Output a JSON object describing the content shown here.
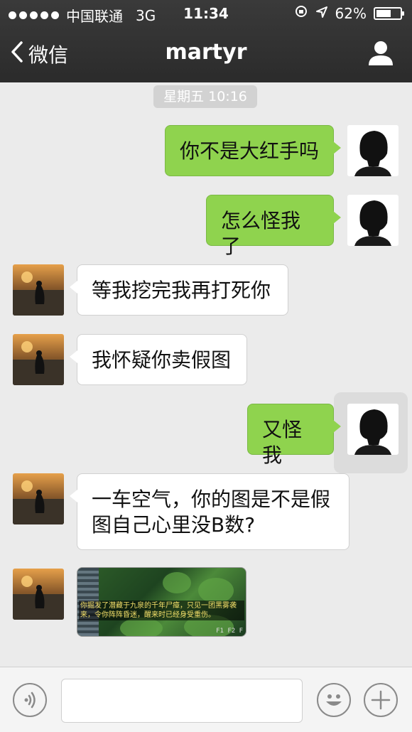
{
  "status_bar": {
    "carrier": "中国联通",
    "network": "3G",
    "time": "11:34",
    "battery_percent": "62%",
    "battery_level": 0.62
  },
  "nav": {
    "back_label": "微信",
    "title": "martyr"
  },
  "chat": {
    "timestamp": "星期五 10:16",
    "messages": [
      {
        "sender": "me",
        "text": "你不是大红手吗"
      },
      {
        "sender": "me",
        "text": "怎么怪我了"
      },
      {
        "sender": "other",
        "text": "等我挖完我再打死你"
      },
      {
        "sender": "other",
        "text": "我怀疑你卖假图"
      },
      {
        "sender": "me",
        "text": "又怪我"
      },
      {
        "sender": "other",
        "text": "一车空气，你的图是不是假图自己心里没B数?"
      },
      {
        "sender": "other",
        "type": "image",
        "caption": "你掘发了潜藏于九泉的千年尸瘴，只见一团黑雾袭来，令你阵阵昏迷，醒来时已经身受重伤。",
        "keys": "F1 F2 F"
      }
    ]
  },
  "colors": {
    "bubble_me": "#8fd34e",
    "bubble_other": "#ffffff",
    "top_bar": "#2e2e2e",
    "background": "#ebebeb"
  },
  "icons": {
    "back": "chevron-left-icon",
    "profile": "person-icon",
    "voice": "voice-icon",
    "emoji": "emoji-icon",
    "plus": "plus-icon"
  }
}
